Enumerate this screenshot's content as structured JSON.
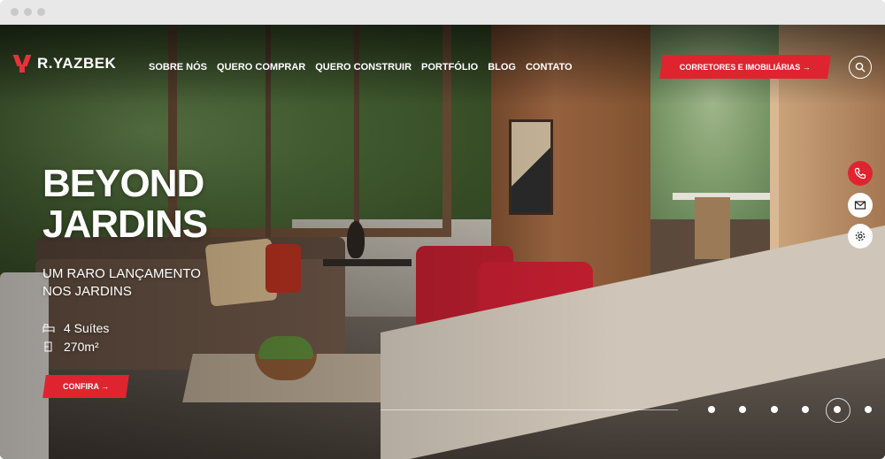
{
  "header": {
    "logo_text": "R.YAZBEK",
    "nav": [
      {
        "label": "SOBRE NÓS"
      },
      {
        "label": "QUERO COMPRAR"
      },
      {
        "label": "QUERO CONSTRUIR"
      },
      {
        "label": "PORTFÓLIO"
      },
      {
        "label": "BLOG"
      },
      {
        "label": "CONTATO"
      }
    ],
    "brokers_cta": "CORRETORES E IMOBILIÁRIAS →",
    "search_icon": "search-icon"
  },
  "hero": {
    "title_line1": "BEYOND",
    "title_line2": "JARDINS",
    "subtitle_line1": "UM RARO LANÇAMENTO",
    "subtitle_line2": "NOS JARDINS",
    "features": [
      {
        "icon": "bed-icon",
        "text": "4 Suítes"
      },
      {
        "icon": "floorplan-icon",
        "text": "270m²"
      }
    ],
    "cta": "CONFIRA →"
  },
  "side_actions": [
    {
      "icon": "phone-icon"
    },
    {
      "icon": "mail-icon"
    },
    {
      "icon": "gear-icon"
    }
  ],
  "slider": {
    "count": 6,
    "active_index": 4
  },
  "colors": {
    "brand_red": "#e0242f",
    "text": "#ffffff"
  }
}
